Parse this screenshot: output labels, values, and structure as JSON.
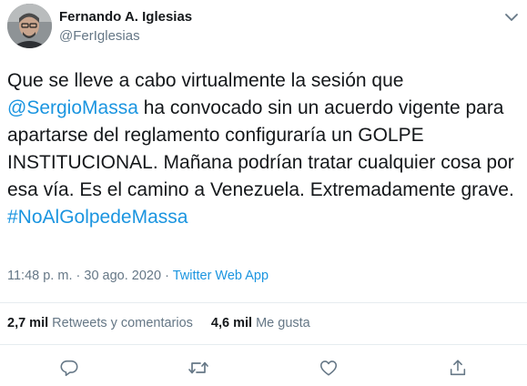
{
  "author": {
    "name": "Fernando A. Iglesias",
    "handle": "@FerIglesias"
  },
  "tweet": {
    "text_before": "Que se lleve a cabo virtualmente la sesión que ",
    "mention": "@SergioMassa",
    "text_after": " ha convocado sin un acuerdo vigente para apartarse del reglamento configuraría un GOLPE INSTITUCIONAL. Mañana podrían tratar cualquier cosa por esa vía. Es el camino a Venezuela. Extremadamente grave.",
    "hashtag": "#NoAlGolpedeMassa"
  },
  "meta": {
    "time": "11:48 p. m.",
    "separator": "·",
    "date": "30 ago. 2020",
    "separator2": "·",
    "source": "Twitter Web App"
  },
  "stats": {
    "retweets_count": "2,7 mil",
    "retweets_label": "Retweets y comentarios",
    "likes_count": "4,6 mil",
    "likes_label": "Me gusta"
  },
  "actions": {
    "reply_icon": "reply-icon",
    "retweet_icon": "retweet-icon",
    "like_icon": "like-icon",
    "share_icon": "share-icon"
  },
  "colors": {
    "link": "#1b95e0",
    "secondary_text": "#657786",
    "icon": "#657786",
    "divider": "#e6ecf0"
  }
}
